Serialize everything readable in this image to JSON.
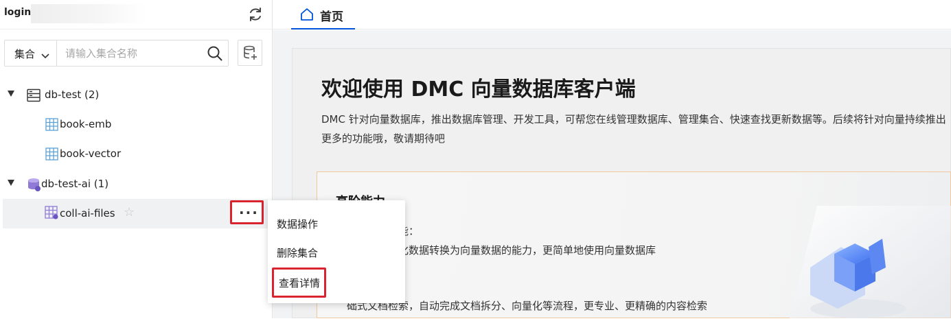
{
  "sidebar": {
    "login_label": "login",
    "search": {
      "type_select": "集合",
      "placeholder": "请输入集合名称"
    },
    "tree": [
      {
        "label": "db-test (2)",
        "children": [
          {
            "label": "book-emb"
          },
          {
            "label": "book-vector"
          }
        ]
      },
      {
        "label": "db-test-ai (1)",
        "children": [
          {
            "label": "coll-ai-files"
          }
        ]
      }
    ],
    "more_label": "···"
  },
  "context_menu": {
    "items": [
      "数据操作",
      "删除集合",
      "查看详情"
    ]
  },
  "tabs": [
    {
      "label": "首页",
      "active": true
    }
  ],
  "main": {
    "title": "欢迎使用 DMC 向量数据库客户端",
    "description": "DMC 针对向量数据库，推出数据库管理、开发工具，可帮您在线管理数据库、管理集合、快速查找更新数据等。后续将针对向量持续推出更多的功能哦，敬请期待吧",
    "feature_title": "高阶能力",
    "feature_line1": "能：",
    "feature_line2": "化数据转换为向量数据的能力，更简单地使用向量数据库",
    "feature_line3": "础式文档检索，自动完成文档拆分、向量化等流程，更专业、更精确的内容检索"
  },
  "colors": {
    "accent": "#0052d9",
    "highlight_border": "#d9232e",
    "table_icon": "#5aa0d8",
    "db_ai_icon": "#8f7ad6"
  }
}
